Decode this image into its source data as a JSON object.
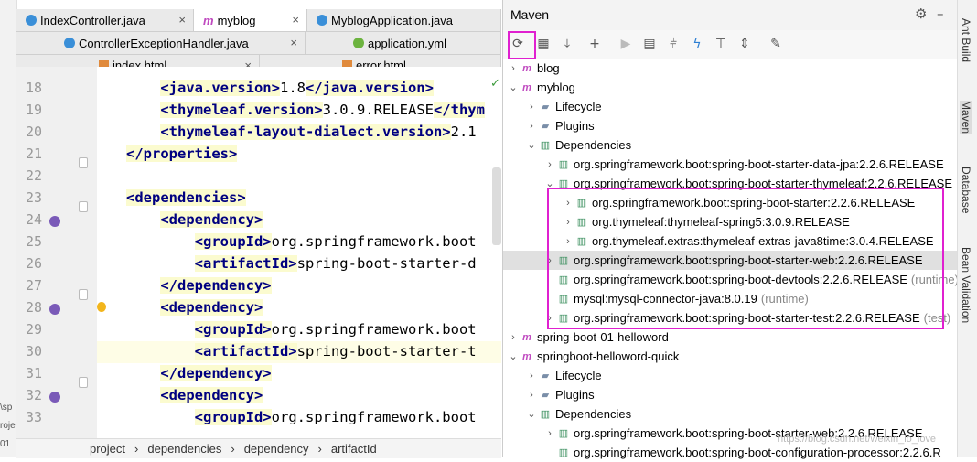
{
  "tabs_row1": [
    {
      "label": "IndexController.java",
      "active": false
    },
    {
      "label": "myblog",
      "active": true
    },
    {
      "label": "MyblogApplication.java",
      "active": false
    }
  ],
  "tabs_row2": [
    {
      "label": "ControllerExceptionHandler.java"
    },
    {
      "label": "application.yml"
    }
  ],
  "tabs_row3": [
    {
      "label": "index.html"
    },
    {
      "label": "error.html"
    }
  ],
  "left_strip": {
    "frag1": "\\sp",
    "frag2": "roje",
    "frag3": "01"
  },
  "editor": {
    "lines": [
      {
        "num": "18",
        "indent": "    ",
        "open": "<java.version>",
        "text": "1.8",
        "close": "</java.version>"
      },
      {
        "num": "19",
        "indent": "    ",
        "open": "<thymeleaf.version>",
        "text": "3.0.9.RELEASE",
        "close": "</thym"
      },
      {
        "num": "20",
        "indent": "    ",
        "open": "<thymeleaf-layout-dialect.version>",
        "text": "2.1",
        "close": ""
      },
      {
        "num": "21",
        "indent": "",
        "open": "</properties>",
        "text": "",
        "close": ""
      },
      {
        "num": "22",
        "indent": "",
        "open": "",
        "text": "",
        "close": ""
      },
      {
        "num": "23",
        "indent": "",
        "open": "<dependencies>",
        "text": "",
        "close": ""
      },
      {
        "num": "24",
        "indent": "    ",
        "open": "<dependency>",
        "text": "",
        "close": ""
      },
      {
        "num": "25",
        "indent": "        ",
        "open": "<groupId>",
        "text": "org.springframework.boot",
        "close": ""
      },
      {
        "num": "26",
        "indent": "        ",
        "open": "<artifactId>",
        "text": "spring-boot-starter-d",
        "close": ""
      },
      {
        "num": "27",
        "indent": "    ",
        "open": "</dependency>",
        "text": "",
        "close": ""
      },
      {
        "num": "28",
        "indent": "    ",
        "open": "<dependency>",
        "text": "",
        "close": ""
      },
      {
        "num": "29",
        "indent": "        ",
        "open": "<groupId>",
        "text": "org.springframework.boot",
        "close": ""
      },
      {
        "num": "30",
        "indent": "        ",
        "open": "<artifactId>",
        "text": "spring-boot-starter-t",
        "close": ""
      },
      {
        "num": "31",
        "indent": "    ",
        "open": "</dependency>",
        "text": "",
        "close": ""
      },
      {
        "num": "32",
        "indent": "    ",
        "open": "<dependency>",
        "text": "",
        "close": ""
      },
      {
        "num": "33",
        "indent": "        ",
        "open": "<groupId>",
        "text": "org.springframework.boot",
        "close": ""
      }
    ]
  },
  "breadcrumb": [
    "project",
    "dependencies",
    "dependency",
    "artifactId"
  ],
  "maven": {
    "title": "Maven",
    "tree": [
      {
        "label": "blog",
        "arrow": "›",
        "icon": "m",
        "scope": ""
      },
      {
        "label": "myblog",
        "arrow": "⌄",
        "icon": "m",
        "scope": ""
      },
      {
        "label": "Lifecycle",
        "arrow": "›",
        "icon": "▰",
        "scope": ""
      },
      {
        "label": "Plugins",
        "arrow": "›",
        "icon": "▰",
        "scope": ""
      },
      {
        "label": "Dependencies",
        "arrow": "⌄",
        "icon": "▥",
        "scope": ""
      },
      {
        "label": "org.springframework.boot:spring-boot-starter-data-jpa:2.2.6.RELEASE",
        "arrow": "›",
        "icon": "▥",
        "scope": ""
      },
      {
        "label": "org.springframework.boot:spring-boot-starter-thymeleaf:2.2.6.RELEASE",
        "arrow": "⌄",
        "icon": "▥",
        "scope": ""
      },
      {
        "label": "org.springframework.boot:spring-boot-starter:2.2.6.RELEASE",
        "arrow": "›",
        "icon": "▥",
        "scope": ""
      },
      {
        "label": "org.thymeleaf:thymeleaf-spring5:3.0.9.RELEASE",
        "arrow": "›",
        "icon": "▥",
        "scope": ""
      },
      {
        "label": "org.thymeleaf.extras:thymeleaf-extras-java8time:3.0.4.RELEASE",
        "arrow": "›",
        "icon": "▥",
        "scope": ""
      },
      {
        "label": "org.springframework.boot:spring-boot-starter-web:2.2.6.RELEASE",
        "arrow": "›",
        "icon": "▥",
        "scope": ""
      },
      {
        "label": "org.springframework.boot:spring-boot-devtools:2.2.6.RELEASE",
        "arrow": "",
        "icon": "▥",
        "scope": "(runtime)"
      },
      {
        "label": "mysql:mysql-connector-java:8.0.19",
        "arrow": "",
        "icon": "▥",
        "scope": "(runtime)"
      },
      {
        "label": "org.springframework.boot:spring-boot-starter-test:2.2.6.RELEASE",
        "arrow": "›",
        "icon": "▥",
        "scope": "(test)"
      },
      {
        "label": "spring-boot-01-helloword",
        "arrow": "›",
        "icon": "m",
        "scope": ""
      },
      {
        "label": "springboot-helloword-quick",
        "arrow": "⌄",
        "icon": "m",
        "scope": ""
      },
      {
        "label": "Lifecycle",
        "arrow": "›",
        "icon": "▰",
        "scope": ""
      },
      {
        "label": "Plugins",
        "arrow": "›",
        "icon": "▰",
        "scope": ""
      },
      {
        "label": "Dependencies",
        "arrow": "⌄",
        "icon": "▥",
        "scope": ""
      },
      {
        "label": "org.springframework.boot:spring-boot-starter-web:2.2.6.RELEASE",
        "arrow": "›",
        "icon": "▥",
        "scope": ""
      },
      {
        "label": "org.springframework.boot:spring-boot-configuration-processor:2.2.6.R",
        "arrow": "",
        "icon": "▥",
        "scope": ""
      }
    ]
  },
  "right_sidebar": [
    "Ant Build",
    "Maven",
    "Database",
    "Bean Validation"
  ],
  "watermark": "https://blog.csdn.net/weixin_lo_love",
  "colors": {
    "highlight_box": "#e020d0",
    "tag": "#000080",
    "selection": "#e0e0e0"
  }
}
